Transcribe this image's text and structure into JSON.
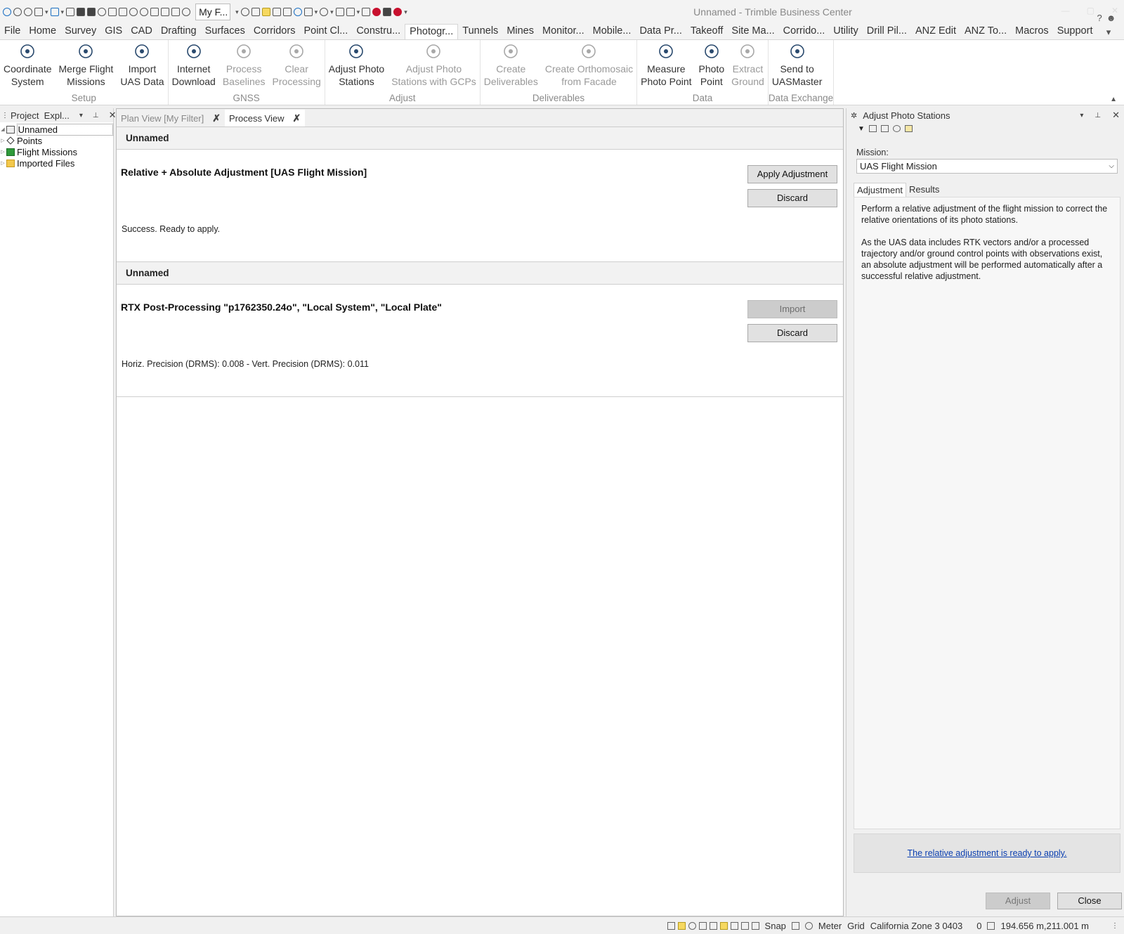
{
  "window": {
    "title": "Unnamed - Trimble Business Center",
    "filter_box": "My F..."
  },
  "menu": {
    "items": [
      "File",
      "Home",
      "Survey",
      "GIS",
      "CAD",
      "Drafting",
      "Surfaces",
      "Corridors",
      "Point Cl...",
      "Constru...",
      "Photogr...",
      "Tunnels",
      "Mines",
      "Monitor...",
      "Mobile...",
      "Data Pr...",
      "Takeoff",
      "Site Ma...",
      "Corrido...",
      "Utility",
      "Drill Pil...",
      "ANZ Edit",
      "ANZ To...",
      "Macros",
      "Support"
    ],
    "active": "Photogr...",
    "help": "?"
  },
  "ribbon": {
    "groups": [
      {
        "label": "Setup",
        "buttons": [
          {
            "line1": "Coordinate",
            "line2": "System",
            "icon": "globe-icon",
            "enabled": true
          },
          {
            "line1": "Merge Flight",
            "line2": "Missions",
            "icon": "drone-icon",
            "enabled": true
          },
          {
            "line1": "Import",
            "line2": "UAS Data",
            "icon": "drone-import-icon",
            "enabled": true
          }
        ]
      },
      {
        "label": "GNSS",
        "buttons": [
          {
            "line1": "Internet",
            "line2": "Download",
            "icon": "cloud-download-icon",
            "enabled": true
          },
          {
            "line1": "Process",
            "line2": "Baselines",
            "icon": "baseline-icon",
            "enabled": false
          },
          {
            "line1": "Clear",
            "line2": "Processing",
            "icon": "clear-baseline-icon",
            "enabled": false
          }
        ]
      },
      {
        "label": "Adjust",
        "buttons": [
          {
            "line1": "Adjust Photo",
            "line2": "Stations",
            "icon": "network-icon",
            "enabled": true
          },
          {
            "line1": "Adjust Photo",
            "line2": "Stations with GCPs",
            "icon": "network-gcp-icon",
            "enabled": false
          }
        ]
      },
      {
        "label": "Deliverables",
        "buttons": [
          {
            "line1": "Create",
            "line2": "Deliverables",
            "icon": "layers-icon",
            "enabled": false
          },
          {
            "line1": "Create Orthomosaic",
            "line2": "from Facade",
            "icon": "facade-icon",
            "enabled": false
          }
        ]
      },
      {
        "label": "Data",
        "buttons": [
          {
            "line1": "Measure",
            "line2": "Photo Point",
            "icon": "measure-point-icon",
            "enabled": true
          },
          {
            "line1": "Photo",
            "line2": "Point",
            "icon": "photo-point-icon",
            "enabled": true
          },
          {
            "line1": "Extract",
            "line2": "Ground",
            "icon": "extract-ground-icon",
            "enabled": false
          }
        ]
      },
      {
        "label": "Data Exchange",
        "buttons": [
          {
            "line1": "Send to",
            "line2": "UASMaster",
            "icon": "send-icon",
            "enabled": true
          }
        ]
      }
    ]
  },
  "explorer": {
    "title": "Project  Expl...",
    "items": [
      {
        "label": "Unnamed",
        "icon": "project-icon",
        "level": 0
      },
      {
        "label": "Points",
        "icon": "point-icon",
        "level": 1
      },
      {
        "label": "Flight Missions",
        "icon": "flight-mission-icon",
        "level": 1
      },
      {
        "label": "Imported Files",
        "icon": "folder-icon",
        "level": 1
      }
    ]
  },
  "tabs": [
    {
      "label": "Plan View [My Filter]",
      "active": false
    },
    {
      "label": "Process View",
      "active": true
    }
  ],
  "process_items": [
    {
      "header": "Unnamed",
      "title": "Relative + Absolute Adjustment [UAS Flight Mission]",
      "status": "Success. Ready to apply.",
      "primary_button": "Apply Adjustment",
      "primary_enabled": true,
      "discard_button": "Discard"
    },
    {
      "header": "Unnamed",
      "title": "RTX Post-Processing \"p1762350.24o\", \"Local System\", \"Local Plate\"",
      "status": "Horiz. Precision (DRMS): 0.008 - Vert. Precision (DRMS): 0.011",
      "primary_button": "Import",
      "primary_enabled": false,
      "discard_button": "Discard"
    }
  ],
  "right_panel": {
    "title": "Adjust Photo Stations",
    "mission_label": "Mission:",
    "mission_value": "UAS Flight Mission",
    "tabs": [
      "Adjustment",
      "Results"
    ],
    "active_tab": "Adjustment",
    "paragraphs": [
      "Perform a relative adjustment of the flight mission to correct the relative orientations of its photo stations.",
      "As the UAS data includes RTK vectors and/or a processed trajectory and/or ground control points with observations exist, an absolute adjustment will be performed automatically after a successful relative adjustment."
    ],
    "message_link": "The relative adjustment is ready to apply.",
    "adjust_button": "Adjust",
    "close_button": "Close"
  },
  "status_bar": {
    "snap": "Snap",
    "units": "Meter",
    "grid": "Grid",
    "zone": "California Zone 3 0403",
    "count": "0",
    "coordinates": "194.656 m,211.001 m"
  },
  "colors": {
    "accent_yellow": "#f6d860",
    "link_blue": "#0b3fb0",
    "stop_red": "#c8102e"
  }
}
